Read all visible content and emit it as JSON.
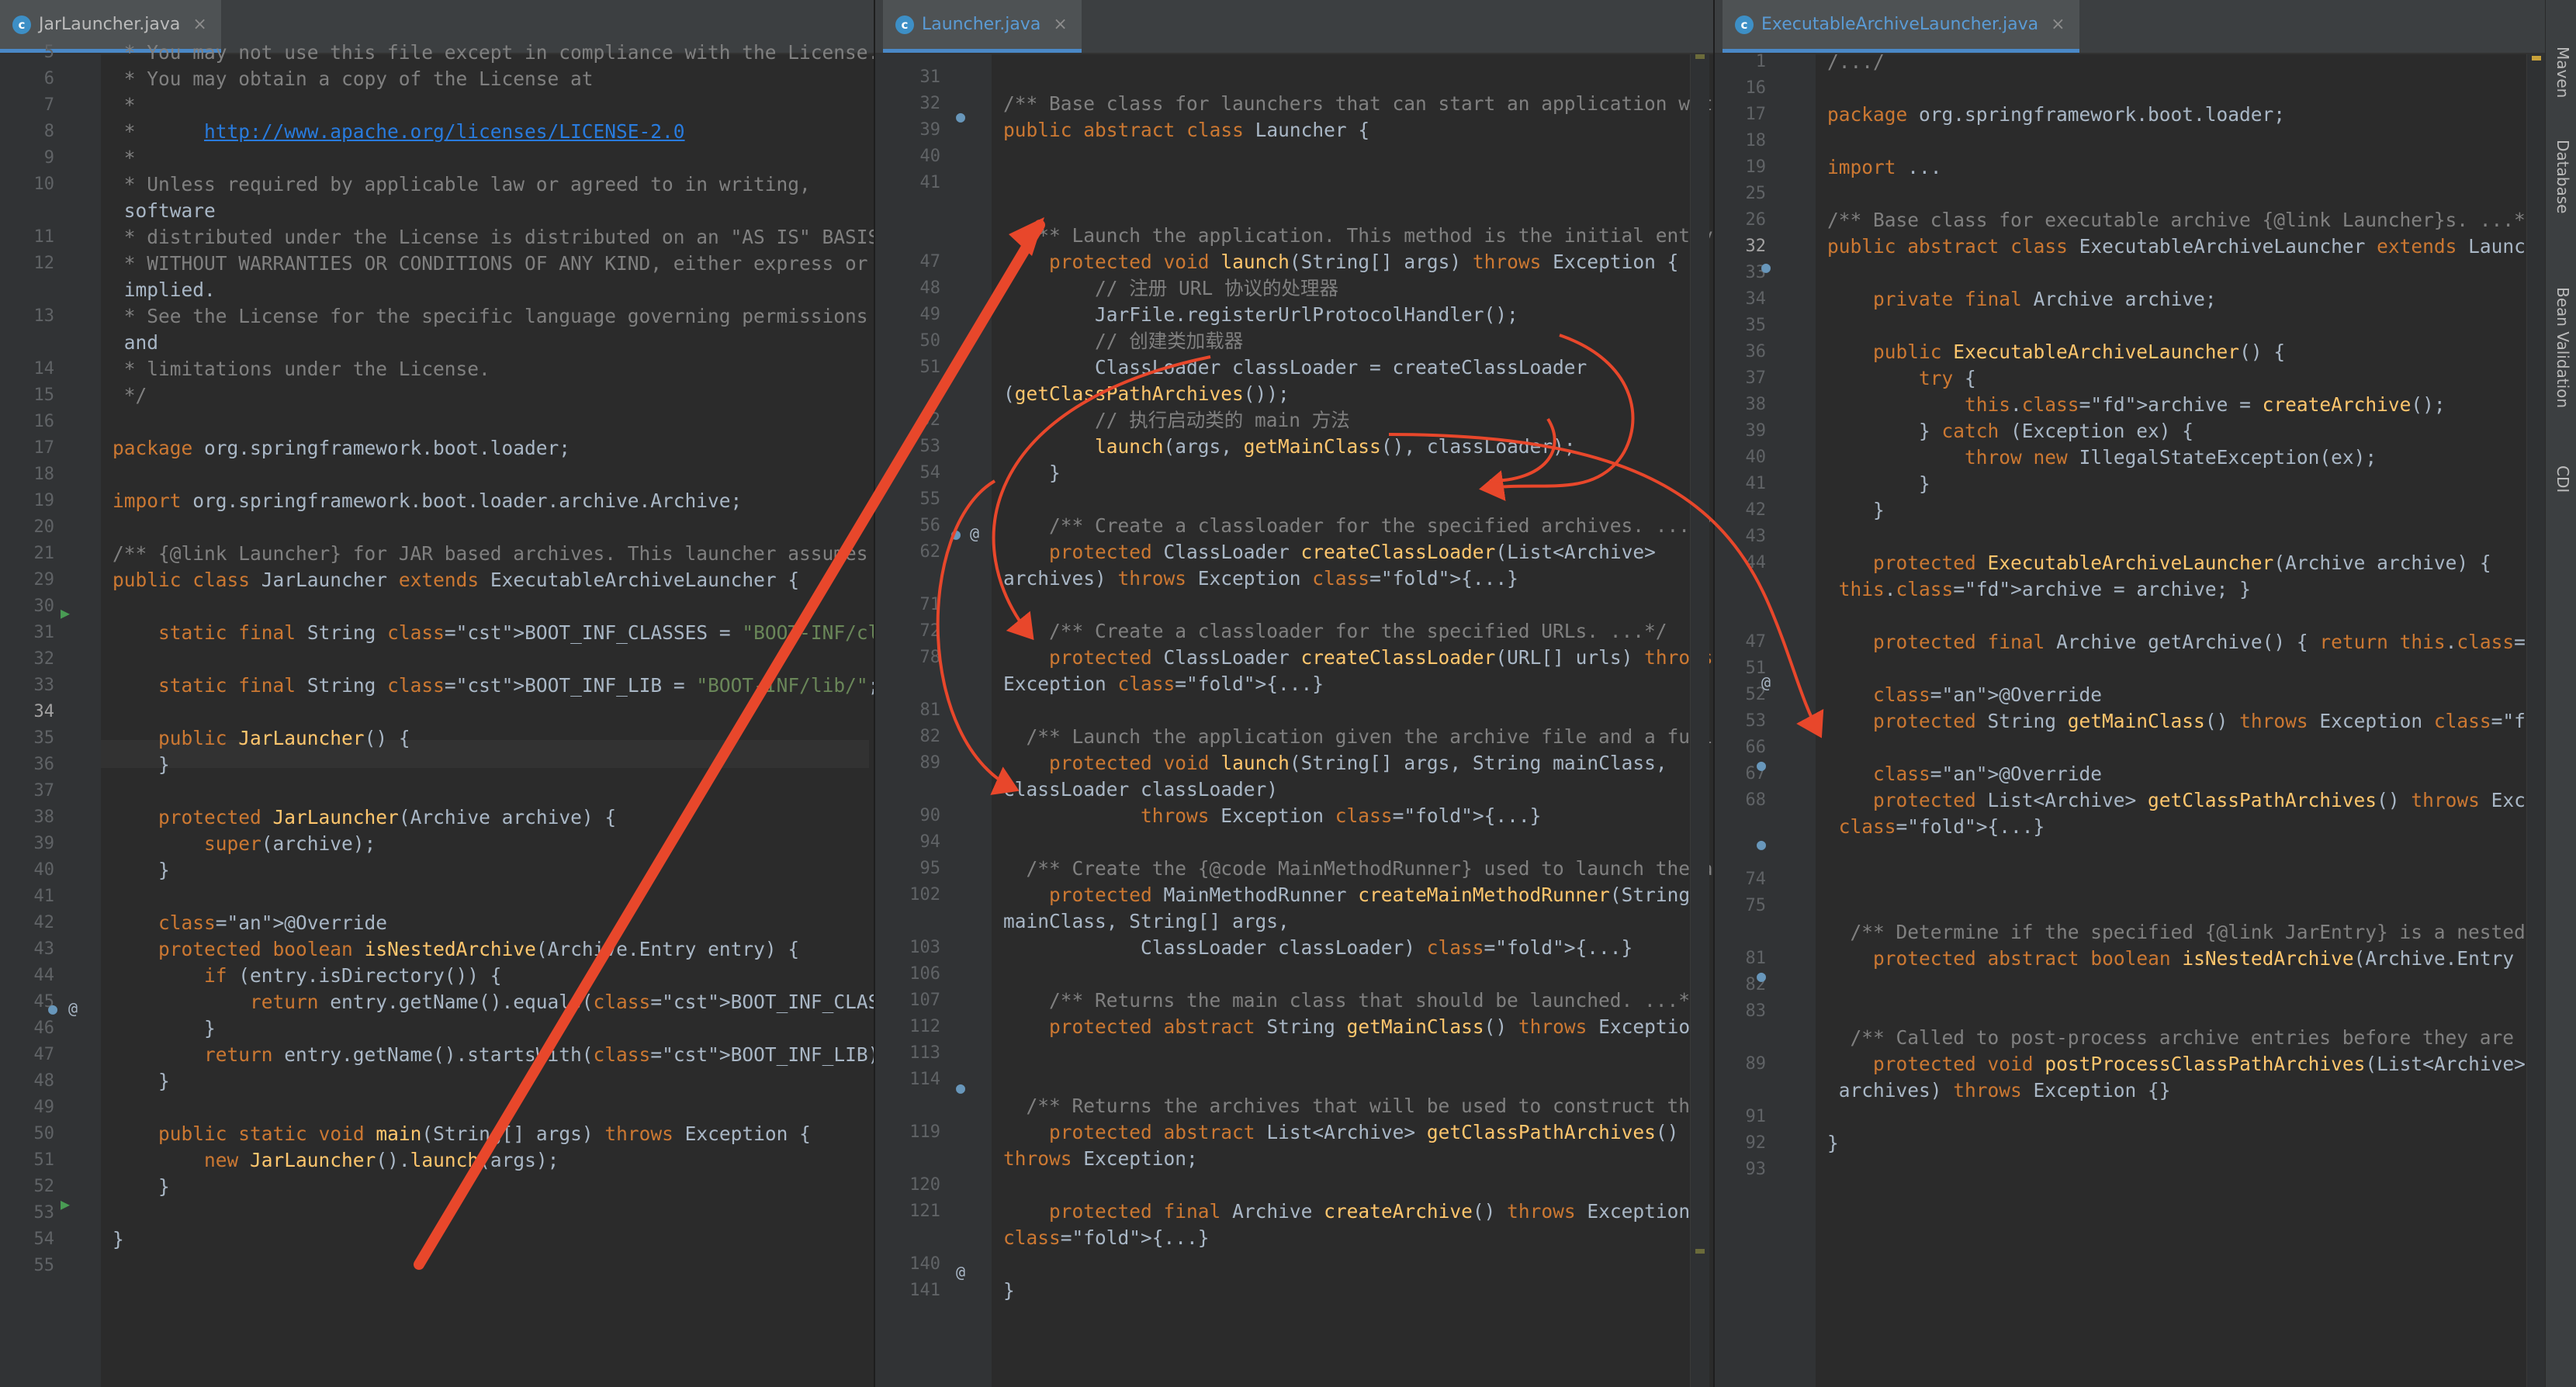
{
  "editors": [
    {
      "tab": {
        "label": "JarLauncher.java",
        "icon": "java-class-icon"
      },
      "lines": [
        {
          "n": "5",
          "t": " * You may not use this file except in compliance with the License."
        },
        {
          "n": "6",
          "t": " * You may obtain a copy of the License at"
        },
        {
          "n": "7",
          "t": " *"
        },
        {
          "n": "8",
          "t": " *      http://www.apache.org/licenses/LICENSE-2.0"
        },
        {
          "n": "9",
          "t": " *"
        },
        {
          "n": "10",
          "t": " * Unless required by applicable law or agreed to in writing,"
        },
        {
          "n": "",
          "t": " software"
        },
        {
          "n": "11",
          "t": " * distributed under the License is distributed on an \"AS IS\" BASIS,"
        },
        {
          "n": "12",
          "t": " * WITHOUT WARRANTIES OR CONDITIONS OF ANY KIND, either express or"
        },
        {
          "n": "",
          "t": " implied."
        },
        {
          "n": "13",
          "t": " * See the License for the specific language governing permissions"
        },
        {
          "n": "",
          "t": " and"
        },
        {
          "n": "14",
          "t": " * limitations under the License."
        },
        {
          "n": "15",
          "t": " */"
        },
        {
          "n": "16",
          "t": ""
        },
        {
          "n": "17",
          "t": "package org.springframework.boot.loader;"
        },
        {
          "n": "18",
          "t": ""
        },
        {
          "n": "19",
          "t": "import org.springframework.boot.loader.archive.Archive;"
        },
        {
          "n": "20",
          "t": ""
        },
        {
          "n": "21",
          "t": "/** {@link Launcher} for JAR based archives. This launcher assumes that"
        },
        {
          "n": "29",
          "t": "public class JarLauncher extends ExecutableArchiveLauncher {"
        },
        {
          "n": "30",
          "t": ""
        },
        {
          "n": "31",
          "t": "    static final String BOOT_INF_CLASSES = \"BOOT-INF/classes/\";"
        },
        {
          "n": "32",
          "t": ""
        },
        {
          "n": "33",
          "t": "    static final String BOOT_INF_LIB = \"BOOT-INF/lib/\";"
        },
        {
          "n": "34",
          "t": ""
        },
        {
          "n": "35",
          "t": "    public JarLauncher() {"
        },
        {
          "n": "36",
          "t": "    }"
        },
        {
          "n": "37",
          "t": ""
        },
        {
          "n": "38",
          "t": "    protected JarLauncher(Archive archive) {"
        },
        {
          "n": "39",
          "t": "        super(archive);"
        },
        {
          "n": "40",
          "t": "    }"
        },
        {
          "n": "41",
          "t": ""
        },
        {
          "n": "42",
          "t": "    @Override"
        },
        {
          "n": "43",
          "t": "    protected boolean isNestedArchive(Archive.Entry entry) {"
        },
        {
          "n": "44",
          "t": "        if (entry.isDirectory()) {"
        },
        {
          "n": "45",
          "t": "            return entry.getName().equals(BOOT_INF_CLASSES);"
        },
        {
          "n": "46",
          "t": "        }"
        },
        {
          "n": "47",
          "t": "        return entry.getName().startsWith(BOOT_INF_LIB);"
        },
        {
          "n": "48",
          "t": "    }"
        },
        {
          "n": "49",
          "t": ""
        },
        {
          "n": "50",
          "t": "    public static void main(String[] args) throws Exception {"
        },
        {
          "n": "51",
          "t": "        new JarLauncher().launch(args);"
        },
        {
          "n": "52",
          "t": "    }"
        },
        {
          "n": "53",
          "t": ""
        },
        {
          "n": "54",
          "t": "}"
        },
        {
          "n": "55",
          "t": ""
        }
      ]
    },
    {
      "tab": {
        "label": "Launcher.java",
        "icon": "java-class-icon"
      },
      "lines": [
        {
          "n": "31",
          "t": ""
        },
        {
          "n": "32",
          "t": "/** Base class for launchers that can start an application with a"
        },
        {
          "n": "39",
          "t": "public abstract class Launcher {"
        },
        {
          "n": "40",
          "t": ""
        },
        {
          "n": "41",
          "t": ""
        },
        {
          "n": "",
          "t": ""
        },
        {
          "n": "",
          "t": "  /** Launch the application. This method is the initial entry point"
        },
        {
          "n": "47",
          "t": "    protected void launch(String[] args) throws Exception {"
        },
        {
          "n": "48",
          "t": "        // 注册 URL 协议的处理器"
        },
        {
          "n": "49",
          "t": "        JarFile.registerUrlProtocolHandler();"
        },
        {
          "n": "50",
          "t": "        // 创建类加载器"
        },
        {
          "n": "51",
          "t": "        ClassLoader classLoader = createClassLoader"
        },
        {
          "n": "",
          "t": "(getClassPathArchives());"
        },
        {
          "n": "52",
          "t": "        // 执行启动类的 main 方法"
        },
        {
          "n": "53",
          "t": "        launch(args, getMainClass(), classLoader);"
        },
        {
          "n": "54",
          "t": "    }"
        },
        {
          "n": "55",
          "t": ""
        },
        {
          "n": "56",
          "t": "    /** Create a classloader for the specified archives. ...*/"
        },
        {
          "n": "62",
          "t": "    protected ClassLoader createClassLoader(List<Archive>"
        },
        {
          "n": "",
          "t": "archives) throws Exception {...}"
        },
        {
          "n": "71",
          "t": ""
        },
        {
          "n": "72",
          "t": "    /** Create a classloader for the specified URLs. ...*/"
        },
        {
          "n": "78",
          "t": "    protected ClassLoader createClassLoader(URL[] urls) throws"
        },
        {
          "n": "",
          "t": "Exception {...}"
        },
        {
          "n": "81",
          "t": ""
        },
        {
          "n": "82",
          "t": "  /** Launch the application given the archive file and a fully configured"
        },
        {
          "n": "89",
          "t": "    protected void launch(String[] args, String mainClass,"
        },
        {
          "n": "",
          "t": "ClassLoader classLoader)"
        },
        {
          "n": "90",
          "t": "            throws Exception {...}"
        },
        {
          "n": "94",
          "t": ""
        },
        {
          "n": "95",
          "t": "  /** Create the {@code MainMethodRunner} used to launch the application"
        },
        {
          "n": "102",
          "t": "    protected MainMethodRunner createMainMethodRunner(String"
        },
        {
          "n": "",
          "t": "mainClass, String[] args,"
        },
        {
          "n": "103",
          "t": "            ClassLoader classLoader) {...}"
        },
        {
          "n": "106",
          "t": ""
        },
        {
          "n": "107",
          "t": "    /** Returns the main class that should be launched. ...*/"
        },
        {
          "n": "112",
          "t": "    protected abstract String getMainClass() throws Exception;"
        },
        {
          "n": "113",
          "t": ""
        },
        {
          "n": "114",
          "t": ""
        },
        {
          "n": "",
          "t": "  /** Returns the archives that will be used to construct the class path"
        },
        {
          "n": "119",
          "t": "    protected abstract List<Archive> getClassPathArchives()"
        },
        {
          "n": "",
          "t": "throws Exception;"
        },
        {
          "n": "120",
          "t": ""
        },
        {
          "n": "121",
          "t": "    protected final Archive createArchive() throws Exception"
        },
        {
          "n": "",
          "t": "{...}"
        },
        {
          "n": "140",
          "t": ""
        },
        {
          "n": "141",
          "t": "}"
        }
      ]
    },
    {
      "tab": {
        "label": "ExecutableArchiveLauncher.java",
        "icon": "java-class-icon"
      },
      "lines": [
        {
          "n": "1",
          "t": "/.../"
        },
        {
          "n": "16",
          "t": ""
        },
        {
          "n": "17",
          "t": "package org.springframework.boot.loader;"
        },
        {
          "n": "18",
          "t": ""
        },
        {
          "n": "19",
          "t": "import ..."
        },
        {
          "n": "25",
          "t": ""
        },
        {
          "n": "26",
          "t": "/** Base class for executable archive {@link Launcher}s. ...*/"
        },
        {
          "n": "32",
          "t": "public abstract class ExecutableArchiveLauncher extends Launcher {"
        },
        {
          "n": "33",
          "t": ""
        },
        {
          "n": "34",
          "t": "    private final Archive archive;"
        },
        {
          "n": "35",
          "t": ""
        },
        {
          "n": "36",
          "t": "    public ExecutableArchiveLauncher() {"
        },
        {
          "n": "37",
          "t": "        try {"
        },
        {
          "n": "38",
          "t": "            this.archive = createArchive();"
        },
        {
          "n": "39",
          "t": "        } catch (Exception ex) {"
        },
        {
          "n": "40",
          "t": "            throw new IllegalStateException(ex);"
        },
        {
          "n": "41",
          "t": "        }"
        },
        {
          "n": "42",
          "t": "    }"
        },
        {
          "n": "43",
          "t": ""
        },
        {
          "n": "44",
          "t": "    protected ExecutableArchiveLauncher(Archive archive) {"
        },
        {
          "n": "",
          "t": " this.archive = archive; }"
        },
        {
          "n": "",
          "t": ""
        },
        {
          "n": "47",
          "t": "    protected final Archive getArchive() { return this.archive; }"
        },
        {
          "n": "51",
          "t": ""
        },
        {
          "n": "52",
          "t": "    @Override"
        },
        {
          "n": "53",
          "t": "    protected String getMainClass() throws Exception {...}"
        },
        {
          "n": "66",
          "t": ""
        },
        {
          "n": "67",
          "t": "    @Override"
        },
        {
          "n": "68",
          "t": "    protected List<Archive> getClassPathArchives() throws Exception"
        },
        {
          "n": "",
          "t": " {...}"
        },
        {
          "n": "",
          "t": ""
        },
        {
          "n": "74",
          "t": ""
        },
        {
          "n": "75",
          "t": ""
        },
        {
          "n": "",
          "t": "  /** Determine if the specified {@link JarEntry} is a nested item that"
        },
        {
          "n": "81",
          "t": "    protected abstract boolean isNestedArchive(Archive.Entry entry);"
        },
        {
          "n": "82",
          "t": ""
        },
        {
          "n": "83",
          "t": ""
        },
        {
          "n": "",
          "t": "  /** Called to post-process archive entries before they are used. Implementations"
        },
        {
          "n": "89",
          "t": "    protected void postProcessClassPathArchives(List<Archive>"
        },
        {
          "n": "",
          "t": " archives) throws Exception {}"
        },
        {
          "n": "91",
          "t": ""
        },
        {
          "n": "92",
          "t": "}"
        },
        {
          "n": "93",
          "t": ""
        }
      ]
    }
  ],
  "toolwindows": [
    "Maven",
    "Database",
    "Bean Validation",
    "CDI"
  ],
  "colors": {
    "annotation_arrow": "#e8472b",
    "accent": "#4a88c7"
  }
}
